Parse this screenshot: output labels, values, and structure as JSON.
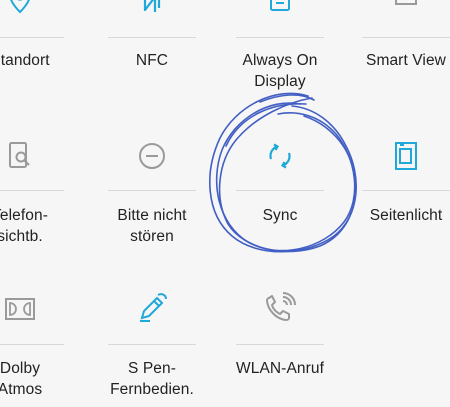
{
  "accent_color": "#1fa8d8",
  "muted_color": "#9a9a9a",
  "scribble_color": "#2f4fbf",
  "tiles": [
    {
      "id": "standort",
      "label": "Standort",
      "icon": "location-pin-icon",
      "active": true
    },
    {
      "id": "nfc",
      "label": "NFC",
      "icon": "nfc-icon",
      "active": true
    },
    {
      "id": "always-on-display",
      "label": "Always On\nDisplay",
      "icon": "always-on-display-icon",
      "active": true
    },
    {
      "id": "smart-view",
      "label": "Smart View",
      "icon": "smart-view-icon",
      "active": false
    },
    {
      "id": "telefon-sichtbarkeit",
      "label": "Telefon-\nsichtb.",
      "icon": "phone-visibility-icon",
      "active": false
    },
    {
      "id": "bitte-nicht-stoeren",
      "label": "Bitte nicht\nstören",
      "icon": "do-not-disturb-icon",
      "active": false
    },
    {
      "id": "sync",
      "label": "Sync",
      "icon": "sync-icon",
      "active": true
    },
    {
      "id": "seitenlicht",
      "label": "Seitenlicht",
      "icon": "edge-lighting-icon",
      "active": true
    },
    {
      "id": "dolby-atmos",
      "label": "Dolby\nAtmos",
      "icon": "dolby-atmos-icon",
      "active": false
    },
    {
      "id": "s-pen-fernbedienung",
      "label": "S Pen-\nFernbedien.",
      "icon": "s-pen-icon",
      "active": true
    },
    {
      "id": "wlan-anruf",
      "label": "WLAN-Anruf",
      "icon": "wifi-calling-icon",
      "active": false
    }
  ]
}
